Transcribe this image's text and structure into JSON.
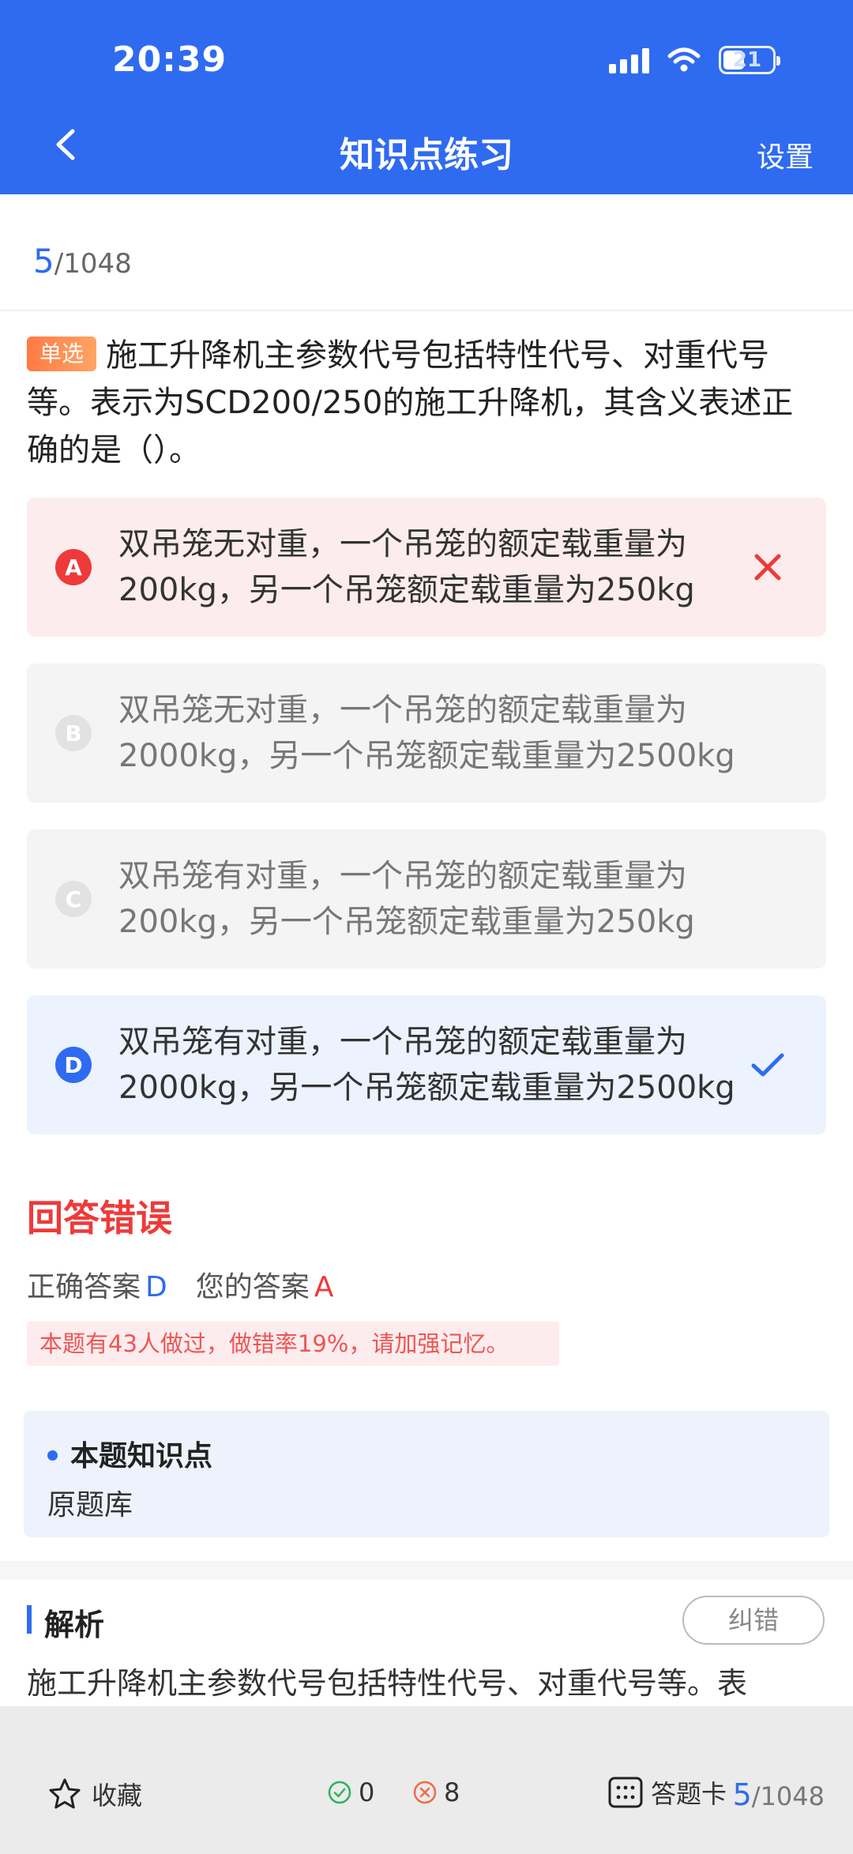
{
  "status_bar": {
    "time": "20:39",
    "battery": "21"
  },
  "nav": {
    "title": "知识点练习",
    "settings_label": "设置"
  },
  "progress": {
    "current": "5",
    "total": "/1048"
  },
  "question": {
    "type_tag": "单选",
    "text": "施工升降机主参数代号包括特性代号、对重代号等。表示为SCD200/250的施工升降机，其含义表述正确的是（）。"
  },
  "options": [
    {
      "letter": "A",
      "text": "双吊笼无对重，一个吊笼的额定载重量为200kg，另一个吊笼额定载重量为250kg",
      "state": "wrong"
    },
    {
      "letter": "B",
      "text": "双吊笼无对重，一个吊笼的额定载重量为2000kg，另一个吊笼额定载重量为2500kg",
      "state": "neutral"
    },
    {
      "letter": "C",
      "text": "双吊笼有对重，一个吊笼的额定载重量为200kg，另一个吊笼额定载重量为250kg",
      "state": "neutral"
    },
    {
      "letter": "D",
      "text": "双吊笼有对重，一个吊笼的额定载重量为2000kg，另一个吊笼额定载重量为2500kg",
      "state": "correct"
    }
  ],
  "result": {
    "title": "回答错误",
    "correct_label": "正确答案",
    "correct_value": "D",
    "yours_label": "您的答案",
    "yours_value": "A",
    "hint": "本题有43人做过，做错率19%，请加强记忆。"
  },
  "knowledge": {
    "title": "本题知识点",
    "value": "原题库"
  },
  "analysis": {
    "title": "解析",
    "report_label": "纠错",
    "text": "施工升降机主参数代号包括特性代号、对重代号等。表"
  },
  "bottom_bar": {
    "favorite_label": "收藏",
    "correct_count": "0",
    "wrong_count": "8",
    "answer_card_label": "答题卡",
    "progress_current": "5",
    "progress_total": "/1048"
  },
  "colors": {
    "primary": "#2f6bf0",
    "error": "#ee3a3a",
    "tag": "#ff7a45"
  },
  "icons": [
    "back-icon",
    "wifi-icon",
    "signal-icon",
    "battery-icon",
    "close-icon",
    "check-icon",
    "star-icon",
    "check-circle-icon",
    "x-circle-icon",
    "grid-icon"
  ]
}
